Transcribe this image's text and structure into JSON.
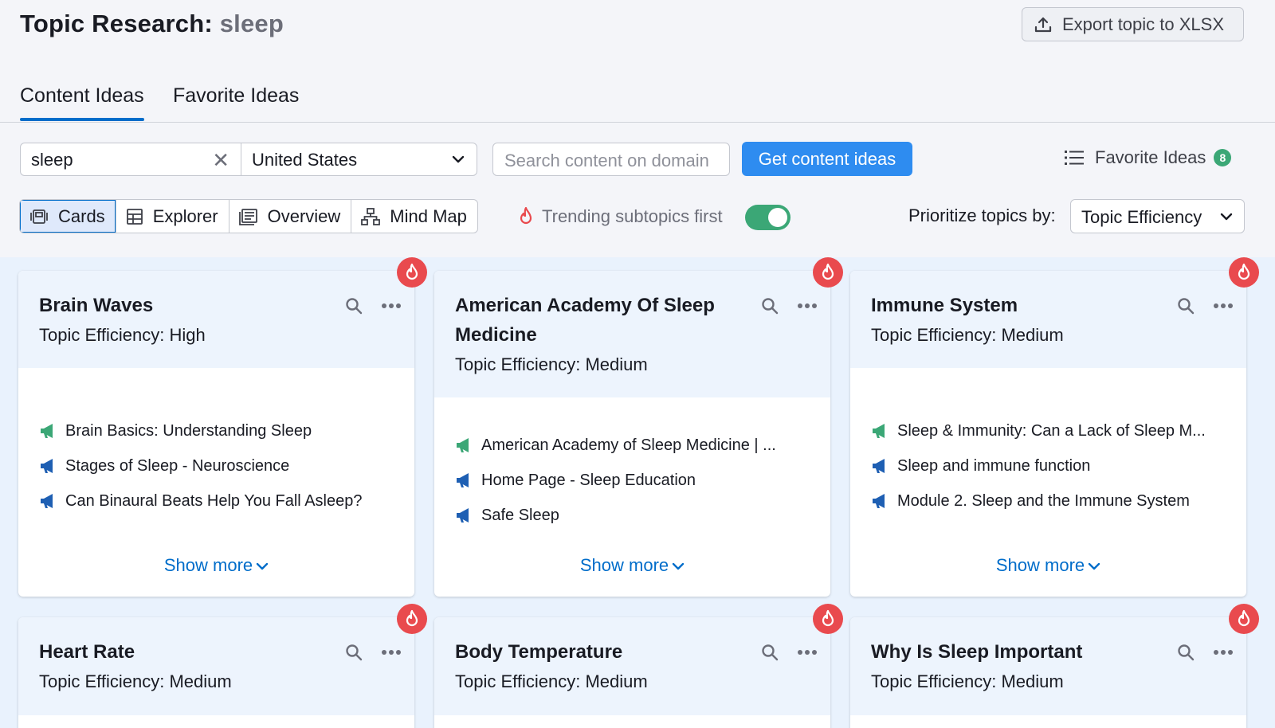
{
  "header": {
    "title_prefix": "Topic Research:",
    "title_keyword": "sleep",
    "export_label": "Export topic to XLSX"
  },
  "tabs": [
    {
      "label": "Content Ideas",
      "active": true
    },
    {
      "label": "Favorite Ideas",
      "active": false
    }
  ],
  "search": {
    "keyword_value": "sleep",
    "country_value": "United States",
    "domain_placeholder": "Search content on domain",
    "submit_label": "Get content ideas",
    "favorites_label": "Favorite Ideas",
    "favorites_count": "8"
  },
  "views": {
    "items": [
      "Cards",
      "Explorer",
      "Overview",
      "Mind Map"
    ],
    "active": "Cards"
  },
  "trending": {
    "label": "Trending subtopics first",
    "enabled": true
  },
  "prioritize": {
    "label": "Prioritize topics by:",
    "value": "Topic Efficiency"
  },
  "colors": {
    "accent": "#006dca",
    "button_blue": "#2e8cf0",
    "success_green": "#3ba776",
    "trend_red": "#e94a4e",
    "megaphone_blue": "#1e5fb3"
  },
  "cards": [
    {
      "title": "Brain Waves",
      "efficiency": "Topic Efficiency: High",
      "ideas": [
        {
          "text": "Brain Basics: Understanding Sleep",
          "icon": "megaphone-green-icon"
        },
        {
          "text": "Stages of Sleep - Neuroscience",
          "icon": "megaphone-blue-icon"
        },
        {
          "text": "Can Binaural Beats Help You Fall Asleep?",
          "icon": "megaphone-blue-icon"
        }
      ],
      "show_more": "Show more",
      "trending": true
    },
    {
      "title": "American Academy Of Sleep Medicine",
      "efficiency": "Topic Efficiency: Medium",
      "ideas": [
        {
          "text": "American Academy of Sleep Medicine | ...",
          "icon": "megaphone-green-icon"
        },
        {
          "text": "Home Page - Sleep Education",
          "icon": "megaphone-blue-icon"
        },
        {
          "text": "Safe Sleep",
          "icon": "megaphone-blue-icon"
        }
      ],
      "show_more": "Show more",
      "trending": true
    },
    {
      "title": "Immune System",
      "efficiency": "Topic Efficiency: Medium",
      "ideas": [
        {
          "text": "Sleep & Immunity: Can a Lack of Sleep M...",
          "icon": "megaphone-green-icon"
        },
        {
          "text": "Sleep and immune function",
          "icon": "megaphone-blue-icon"
        },
        {
          "text": "Module 2. Sleep and the Immune System",
          "icon": "megaphone-blue-icon"
        }
      ],
      "show_more": "Show more",
      "trending": true
    },
    {
      "title": "Heart Rate",
      "efficiency": "Topic Efficiency: Medium",
      "ideas": [],
      "show_more": "",
      "trending": true
    },
    {
      "title": "Body Temperature",
      "efficiency": "Topic Efficiency: Medium",
      "ideas": [],
      "show_more": "",
      "trending": true
    },
    {
      "title": "Why Is Sleep Important",
      "efficiency": "Topic Efficiency: Medium",
      "ideas": [],
      "show_more": "",
      "trending": true
    }
  ]
}
